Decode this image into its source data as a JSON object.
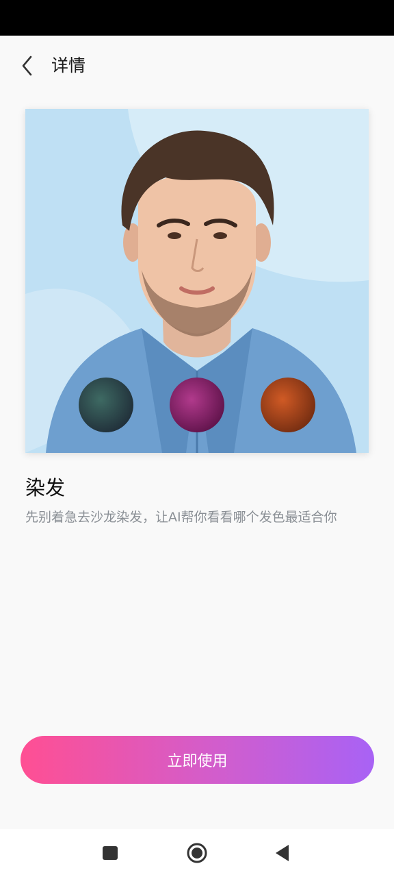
{
  "header": {
    "title": "详情"
  },
  "feature": {
    "title": "染发",
    "description": "先别着急去沙龙染发，让AI帮你看看哪个发色最适合你"
  },
  "action": {
    "label": "立即使用"
  },
  "swatches": [
    {
      "name": "teal-green",
      "color": "#2f4a4d"
    },
    {
      "name": "magenta",
      "color": "#8a1f6b"
    },
    {
      "name": "copper",
      "color": "#a3411b"
    }
  ],
  "nav": {
    "items": [
      "square-icon",
      "circle-icon",
      "triangle-back-icon"
    ]
  },
  "colors": {
    "accent_start": "#ff4f93",
    "accent_end": "#a862f5",
    "background": "#f9f9f9"
  }
}
